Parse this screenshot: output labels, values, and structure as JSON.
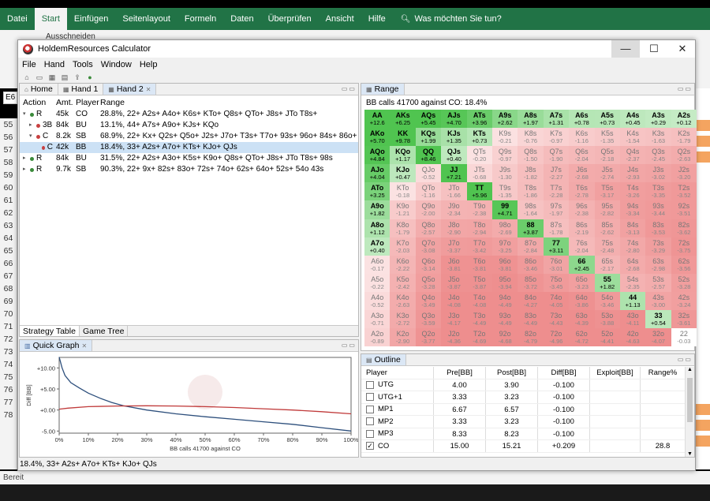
{
  "excel": {
    "tabs": [
      "Datei",
      "Start",
      "Einfügen",
      "Seitenlayout",
      "Formeln",
      "Daten",
      "Überprüfen",
      "Ansicht",
      "Hilfe"
    ],
    "active_tab": "Start",
    "tell_me": "Was möchten Sie tun?",
    "cut_label": "Ausschneiden",
    "name_box": "E6",
    "row_numbers": [
      "55",
      "56",
      "57",
      "58",
      "59",
      "60",
      "61",
      "62",
      "63",
      "64",
      "65",
      "66",
      "67",
      "68",
      "69",
      "70",
      "71",
      "72",
      "73",
      "74",
      "75",
      "76",
      "77",
      "78"
    ],
    "status": "Bereit"
  },
  "calc": {
    "title": "HoldemResources Calculator",
    "menu": [
      "File",
      "Hand",
      "Tools",
      "Window",
      "Help"
    ],
    "hand_tabs": [
      "Home",
      "Hand 1",
      "Hand 2"
    ],
    "active_hand_tab": "Hand 2",
    "table_headers": {
      "action": "Action",
      "amt": "Amt.",
      "player": "Player",
      "range": "Range"
    },
    "strategy_rows": [
      {
        "level": 0,
        "dot": "green",
        "expand": "v",
        "action": "R",
        "amt": "45k",
        "player": "CO",
        "range": "28.8%, 22+ A2s+ A4o+ K6s+ KTo+ Q8s+ QTo+ J8s+ JTo T8s+"
      },
      {
        "level": 1,
        "dot": "red",
        "expand": ">",
        "action": "3B",
        "amt": "84k",
        "player": "BU",
        "range": "13.1%, 44+ A7s+ A9o+ KJs+ KQo"
      },
      {
        "level": 1,
        "dot": "red",
        "expand": "v",
        "action": "C",
        "amt": "8.2k",
        "player": "SB",
        "range": "68.9%, 22+ Kx+ Q2s+ Q5o+ J2s+ J7o+ T3s+ T7o+ 93s+ 96o+ 84s+ 86o+ 73"
      },
      {
        "level": 2,
        "dot": "red",
        "expand": "",
        "action": "C",
        "amt": "42k",
        "player": "BB",
        "range": "18.4%, 33+ A2s+ A7o+ KTs+ KJo+ QJs"
      },
      {
        "level": 0,
        "dot": "green",
        "expand": ">",
        "action": "R",
        "amt": "84k",
        "player": "BU",
        "range": "31.5%, 22+ A2s+ A3o+ K5s+ K9o+ Q8s+ QTo+ J8s+ JTo T8s+ 98s"
      },
      {
        "level": 0,
        "dot": "green",
        "expand": ">",
        "action": "R",
        "amt": "9.7k",
        "player": "SB",
        "range": "90.3%, 22+ 9x+ 82s+ 83o+ 72s+ 74o+ 62s+ 64o+ 52s+ 54o 43s"
      }
    ],
    "selected_row": 3,
    "bottom_tabs": [
      "Strategy Table",
      "Game Tree"
    ],
    "quick_graph_tab": "Quick Graph",
    "range_tab": "Range",
    "range_title": "BB calls 41700 against CO: 18.4%",
    "range_cells": [
      [
        "AA",
        "+12.6"
      ],
      [
        "AKs",
        "+6.25"
      ],
      [
        "AQs",
        "+5.45"
      ],
      [
        "AJs",
        "+4.70"
      ],
      [
        "ATs",
        "+3.96"
      ],
      [
        "A9s",
        "+2.62"
      ],
      [
        "A8s",
        "+1.97"
      ],
      [
        "A7s",
        "+1.31"
      ],
      [
        "A6s",
        "+0.78"
      ],
      [
        "A5s",
        "+0.73"
      ],
      [
        "A4s",
        "+0.45"
      ],
      [
        "A3s",
        "+0.29"
      ],
      [
        "A2s",
        "+0.12"
      ],
      [
        "AKo",
        "+5.70"
      ],
      [
        "KK",
        "+9.78"
      ],
      [
        "KQs",
        "+1.99"
      ],
      [
        "KJs",
        "+1.35"
      ],
      [
        "KTs",
        "+0.73"
      ],
      [
        "K9s",
        "-0.21"
      ],
      [
        "K8s",
        "-0.76"
      ],
      [
        "K7s",
        "-0.97"
      ],
      [
        "K6s",
        "-1.16"
      ],
      [
        "K5s",
        "-1.35"
      ],
      [
        "K4s",
        "-1.54"
      ],
      [
        "K3s",
        "-1.63"
      ],
      [
        "K2s",
        "-1.79"
      ],
      [
        "AQo",
        "+4.84"
      ],
      [
        "KQo",
        "+1.17"
      ],
      [
        "QQ",
        "+8.46"
      ],
      [
        "QJs",
        "+0.40"
      ],
      [
        "QTs",
        "-0.20"
      ],
      [
        "Q9s",
        "-0.97"
      ],
      [
        "Q8s",
        "-1.50"
      ],
      [
        "Q7s",
        "-1.90"
      ],
      [
        "Q6s",
        "-2.04"
      ],
      [
        "Q5s",
        "-2.18"
      ],
      [
        "Q4s",
        "-2.37"
      ],
      [
        "Q3s",
        "-2.45"
      ],
      [
        "Q2s",
        "-2.63"
      ],
      [
        "AJo",
        "+4.04"
      ],
      [
        "KJo",
        "+0.47"
      ],
      [
        "QJo",
        "-0.52"
      ],
      [
        "JJ",
        "+7.21"
      ],
      [
        "JTs",
        "-0.68"
      ],
      [
        "J9s",
        "-1.30"
      ],
      [
        "J8s",
        "-1.82"
      ],
      [
        "J7s",
        "-2.27"
      ],
      [
        "J6s",
        "-2.68"
      ],
      [
        "J5s",
        "-2.74"
      ],
      [
        "J4s",
        "-2.93"
      ],
      [
        "J3s",
        "-3.02"
      ],
      [
        "J2s",
        "-3.20"
      ],
      [
        "ATo",
        "+3.25"
      ],
      [
        "KTo",
        "-0.18"
      ],
      [
        "QTo",
        "-1.16"
      ],
      [
        "JTo",
        "-1.66"
      ],
      [
        "TT",
        "+5.96"
      ],
      [
        "T9s",
        "-1.35"
      ],
      [
        "T8s",
        "-1.86"
      ],
      [
        "T7s",
        "-2.28"
      ],
      [
        "T6s",
        "-2.78"
      ],
      [
        "T5s",
        "-3.17"
      ],
      [
        "T4s",
        "-3.26"
      ],
      [
        "T3s",
        "-3.35"
      ],
      [
        "T2s",
        "-3.52"
      ],
      [
        "A9o",
        "+1.82"
      ],
      [
        "K9o",
        "-1.21"
      ],
      [
        "Q9o",
        "-2.00"
      ],
      [
        "J9o",
        "-2.34"
      ],
      [
        "T9o",
        "-2.38"
      ],
      [
        "99",
        "+4.71"
      ],
      [
        "98s",
        "-1.64"
      ],
      [
        "97s",
        "-1.97"
      ],
      [
        "96s",
        "-2.38"
      ],
      [
        "95s",
        "-2.82"
      ],
      [
        "94s",
        "-3.34"
      ],
      [
        "93s",
        "-3.44"
      ],
      [
        "92s",
        "-3.51"
      ],
      [
        "A8o",
        "+1.12"
      ],
      [
        "K8o",
        "-1.79"
      ],
      [
        "Q8o",
        "-2.57"
      ],
      [
        "J8o",
        "-2.90"
      ],
      [
        "T8o",
        "-2.94"
      ],
      [
        "98o",
        "-2.69"
      ],
      [
        "88",
        "+3.87"
      ],
      [
        "87s",
        "-1.78"
      ],
      [
        "86s",
        "-2.19"
      ],
      [
        "85s",
        "-2.62"
      ],
      [
        "84s",
        "-3.13"
      ],
      [
        "83s",
        "-3.53"
      ],
      [
        "82s",
        "-3.62"
      ],
      [
        "A7o",
        "+0.40"
      ],
      [
        "K7o",
        "-2.03"
      ],
      [
        "Q7o",
        "-3.08"
      ],
      [
        "J7o",
        "-3.37"
      ],
      [
        "T7o",
        "-3.42"
      ],
      [
        "97o",
        "-3.25"
      ],
      [
        "87o",
        "-2.84"
      ],
      [
        "77",
        "+3.11"
      ],
      [
        "76s",
        "-2.04"
      ],
      [
        "75s",
        "-2.48"
      ],
      [
        "74s",
        "-2.80"
      ],
      [
        "73s",
        "-3.29"
      ],
      [
        "72s",
        "-3.75"
      ],
      [
        "A6o",
        "-0.17"
      ],
      [
        "K6o",
        "-2.22"
      ],
      [
        "Q6o",
        "-3.14"
      ],
      [
        "J6o",
        "-3.81"
      ],
      [
        "T6o",
        "-3.81"
      ],
      [
        "96o",
        "-3.81"
      ],
      [
        "86o",
        "-3.46"
      ],
      [
        "76o",
        "-3.01"
      ],
      [
        "66",
        "+2.45"
      ],
      [
        "65s",
        "-2.17"
      ],
      [
        "64s",
        "-2.68"
      ],
      [
        "63s",
        "-2.98"
      ],
      [
        "62s",
        "-3.56"
      ],
      [
        "A5o",
        "-0.22"
      ],
      [
        "K5o",
        "-2.42"
      ],
      [
        "Q5o",
        "-3.28"
      ],
      [
        "J5o",
        "-3.87"
      ],
      [
        "T5o",
        "-3.87"
      ],
      [
        "95o",
        "-3.94"
      ],
      [
        "85o",
        "-3.72"
      ],
      [
        "75o",
        "-3.45"
      ],
      [
        "65o",
        "-3.23"
      ],
      [
        "55",
        "+1.82"
      ],
      [
        "54s",
        "-2.35"
      ],
      [
        "53s",
        "-2.57"
      ],
      [
        "52s",
        "-3.28"
      ],
      [
        "A4o",
        "-0.52"
      ],
      [
        "K4o",
        "-2.63"
      ],
      [
        "Q4o",
        "-3.49"
      ],
      [
        "J4o",
        "-4.08"
      ],
      [
        "T4o",
        "-4.08"
      ],
      [
        "94o",
        "-4.49"
      ],
      [
        "84o",
        "-4.27"
      ],
      [
        "74o",
        "-4.05"
      ],
      [
        "64o",
        "-3.86"
      ],
      [
        "54o",
        "-3.46"
      ],
      [
        "44",
        "+1.13"
      ],
      [
        "43s",
        "-3.00"
      ],
      [
        "42s",
        "-3.24"
      ],
      [
        "A3o",
        "-0.71"
      ],
      [
        "K3o",
        "-2.72"
      ],
      [
        "Q3o",
        "-3.59"
      ],
      [
        "J3o",
        "-4.17"
      ],
      [
        "T3o",
        "-4.49"
      ],
      [
        "93o",
        "-4.49"
      ],
      [
        "83o",
        "-4.49"
      ],
      [
        "73o",
        "-4.43"
      ],
      [
        "63o",
        "-4.39"
      ],
      [
        "53o",
        "-3.88"
      ],
      [
        "43o",
        "-4.11"
      ],
      [
        "33",
        "+0.54"
      ],
      [
        "32s",
        "-3.61"
      ],
      [
        "A2o",
        "-0.89"
      ],
      [
        "K2o",
        "-2.90"
      ],
      [
        "Q2o",
        "-3.77"
      ],
      [
        "J2o",
        "-4.36"
      ],
      [
        "T2o",
        "-4.69"
      ],
      [
        "92o",
        "-4.68"
      ],
      [
        "82o",
        "-4.79"
      ],
      [
        "72o",
        "-4.96"
      ],
      [
        "62o",
        "-4.72"
      ],
      [
        "52o",
        "-4.41"
      ],
      [
        "42o",
        "-4.63"
      ],
      [
        "32o",
        "-4.07"
      ],
      [
        "22",
        "-0.03"
      ]
    ],
    "outline_tab": "Outline",
    "outline_headers": [
      "Player",
      "Pre[BB]",
      "Post[BB]",
      "Diff[BB]",
      "Exploit[BB]",
      "Range%"
    ],
    "outline_rows": [
      {
        "checked": false,
        "player": "UTG",
        "pre": "4.00",
        "post": "3.90",
        "diff": "-0.100",
        "exploit": "",
        "range": ""
      },
      {
        "checked": false,
        "player": "UTG+1",
        "pre": "3.33",
        "post": "3.23",
        "diff": "-0.100",
        "exploit": "",
        "range": ""
      },
      {
        "checked": false,
        "player": "MP1",
        "pre": "6.67",
        "post": "6.57",
        "diff": "-0.100",
        "exploit": "",
        "range": ""
      },
      {
        "checked": false,
        "player": "MP2",
        "pre": "3.33",
        "post": "3.23",
        "diff": "-0.100",
        "exploit": "",
        "range": ""
      },
      {
        "checked": false,
        "player": "MP3",
        "pre": "8.33",
        "post": "8.23",
        "diff": "-0.100",
        "exploit": "",
        "range": ""
      },
      {
        "checked": true,
        "player": "CO",
        "pre": "15.00",
        "post": "15.21",
        "diff": "+0.209",
        "exploit": "",
        "range": "28.8"
      }
    ],
    "status": "18.4%, 33+ A2s+ A7o+ KTs+ KJo+ QJs",
    "colors": {
      "green_strong": "#4fc24f",
      "green_light": "#bfeabf",
      "red_light": "#fbe2e2",
      "red_strong": "#ee8e8e",
      "selected": "#cce1f5"
    }
  },
  "chart_data": {
    "type": "line",
    "xlabel": "BB calls 41700 against CO",
    "ylabel": "Diff [BB]",
    "x_ticks": [
      "0%",
      "10%",
      "20%",
      "30%",
      "40%",
      "50%",
      "60%",
      "70%",
      "80%",
      "90%",
      "100%"
    ],
    "y_ticks": [
      "+10.00",
      "+5.00",
      "+0.00",
      "-5.00"
    ],
    "ylim": [
      -5.5,
      12.5
    ],
    "xlim": [
      0,
      100
    ],
    "series": [
      {
        "color": "#2d4f7c",
        "x": [
          0,
          1,
          2,
          4,
          7,
          10,
          14,
          18,
          22,
          30,
          40,
          50,
          60,
          70,
          80,
          90,
          100
        ],
        "y": [
          12.6,
          10,
          8.2,
          6.5,
          5.2,
          4,
          2.8,
          1.8,
          1,
          0,
          -0.9,
          -1.6,
          -2.2,
          -2.8,
          -3.4,
          -4.2,
          -5
        ]
      },
      {
        "color": "#c03a3a",
        "x": [
          0,
          3,
          10,
          20,
          30,
          40,
          50,
          60,
          70,
          80,
          90,
          100
        ],
        "y": [
          0.2,
          0.45,
          0.8,
          0.95,
          1,
          0.95,
          0.8,
          0.6,
          0.3,
          0,
          -0.4,
          -0.9
        ]
      }
    ]
  }
}
